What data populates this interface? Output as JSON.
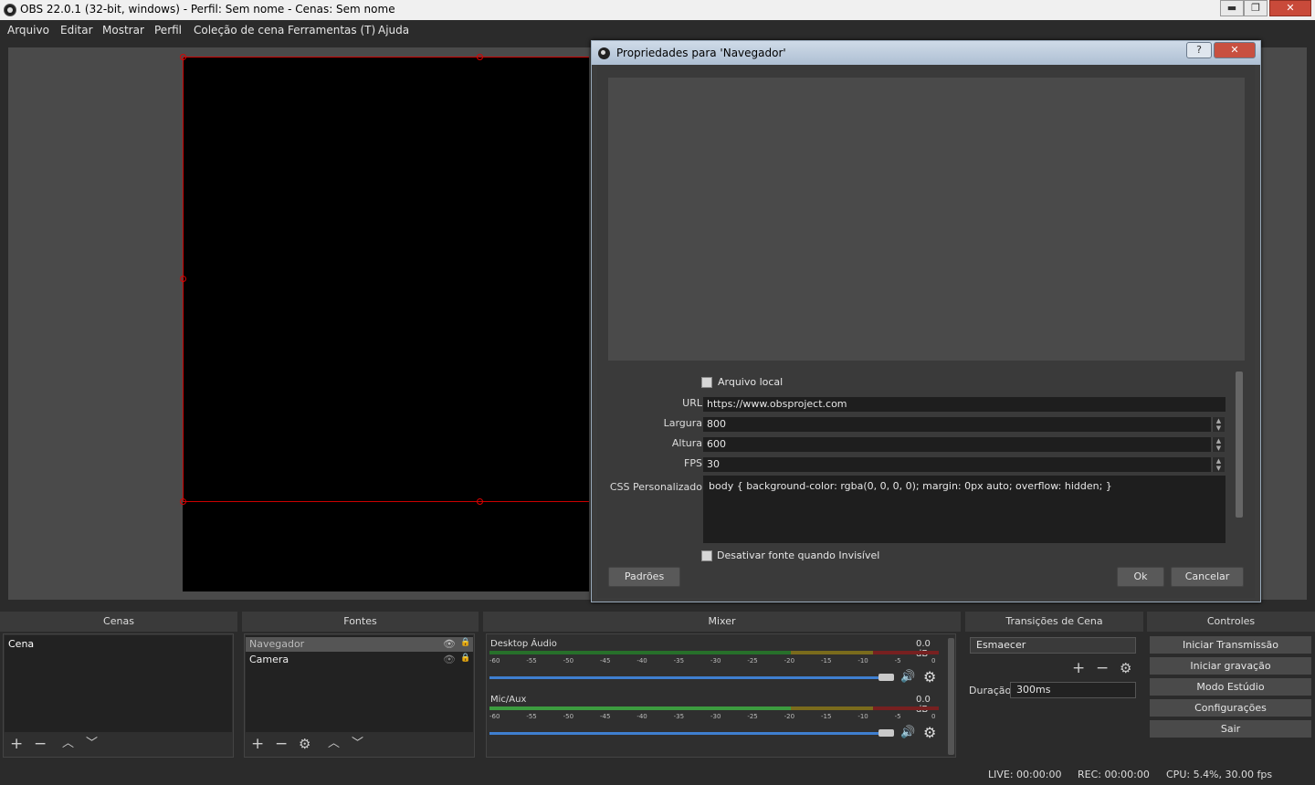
{
  "window": {
    "title": "OBS 22.0.1 (32-bit, windows) - Perfil: Sem nome - Cenas: Sem nome",
    "minimize": "▬",
    "maximize": "❐",
    "close": "✕"
  },
  "menu": [
    "Arquivo",
    "Editar",
    "Mostrar",
    "Perfil",
    "Coleção de cena",
    "Ferramentas (T)",
    "Ajuda"
  ],
  "dialog": {
    "title": "Propriedades para 'Navegador'",
    "help": "?",
    "close": "✕",
    "local_file_label": "Arquivo local",
    "url_label": "URL",
    "url_value": "https://www.obsproject.com",
    "width_label": "Largura",
    "width_value": "800",
    "height_label": "Altura",
    "height_value": "600",
    "fps_label": "FPS",
    "fps_value": "30",
    "css_label": "CSS Personalizado",
    "css_value": "body { background-color: rgba(0, 0, 0, 0); margin: 0px auto; overflow: hidden; }",
    "shutdown_label": "Desativar fonte quando Invisível",
    "defaults_btn": "Padrões",
    "ok_btn": "Ok",
    "cancel_btn": "Cancelar"
  },
  "docks": {
    "scenes": {
      "title": "Cenas",
      "items": [
        "Cena"
      ]
    },
    "sources": {
      "title": "Fontes",
      "items": [
        "Navegador",
        "Camera"
      ]
    },
    "mixer": {
      "title": "Mixer",
      "tracks": [
        {
          "name": "Desktop Áudio",
          "level": "0.0 dB"
        },
        {
          "name": "Mic/Aux",
          "level": "0.0 dB"
        }
      ],
      "scale": [
        "-60",
        "-55",
        "-50",
        "-45",
        "-40",
        "-35",
        "-30",
        "-25",
        "-20",
        "-15",
        "-10",
        "-5",
        "0"
      ]
    },
    "transitions": {
      "title": "Transições de Cena",
      "selected": "Esmaecer",
      "duration_label": "Duração",
      "duration_value": "300ms"
    },
    "controls": {
      "title": "Controles",
      "buttons": [
        "Iniciar Transmissão",
        "Iniciar gravação",
        "Modo Estúdio",
        "Configurações",
        "Sair"
      ]
    }
  },
  "status": {
    "live": "LIVE: 00:00:00",
    "rec": "REC: 00:00:00",
    "cpu": "CPU: 5.4%, 30.00 fps"
  },
  "icons": {
    "add": "+",
    "remove": "−",
    "up": "︿",
    "down": "﹀",
    "gear": "⚙",
    "speaker": "🔊",
    "eye": "👁",
    "lock": "🔒"
  },
  "colors": {
    "selection_border": "#cc0000",
    "volume_slider": "#3f7fd0",
    "meter_green": "#27702a",
    "meter_yellow": "#7a6b1c",
    "meter_red": "#772020"
  }
}
